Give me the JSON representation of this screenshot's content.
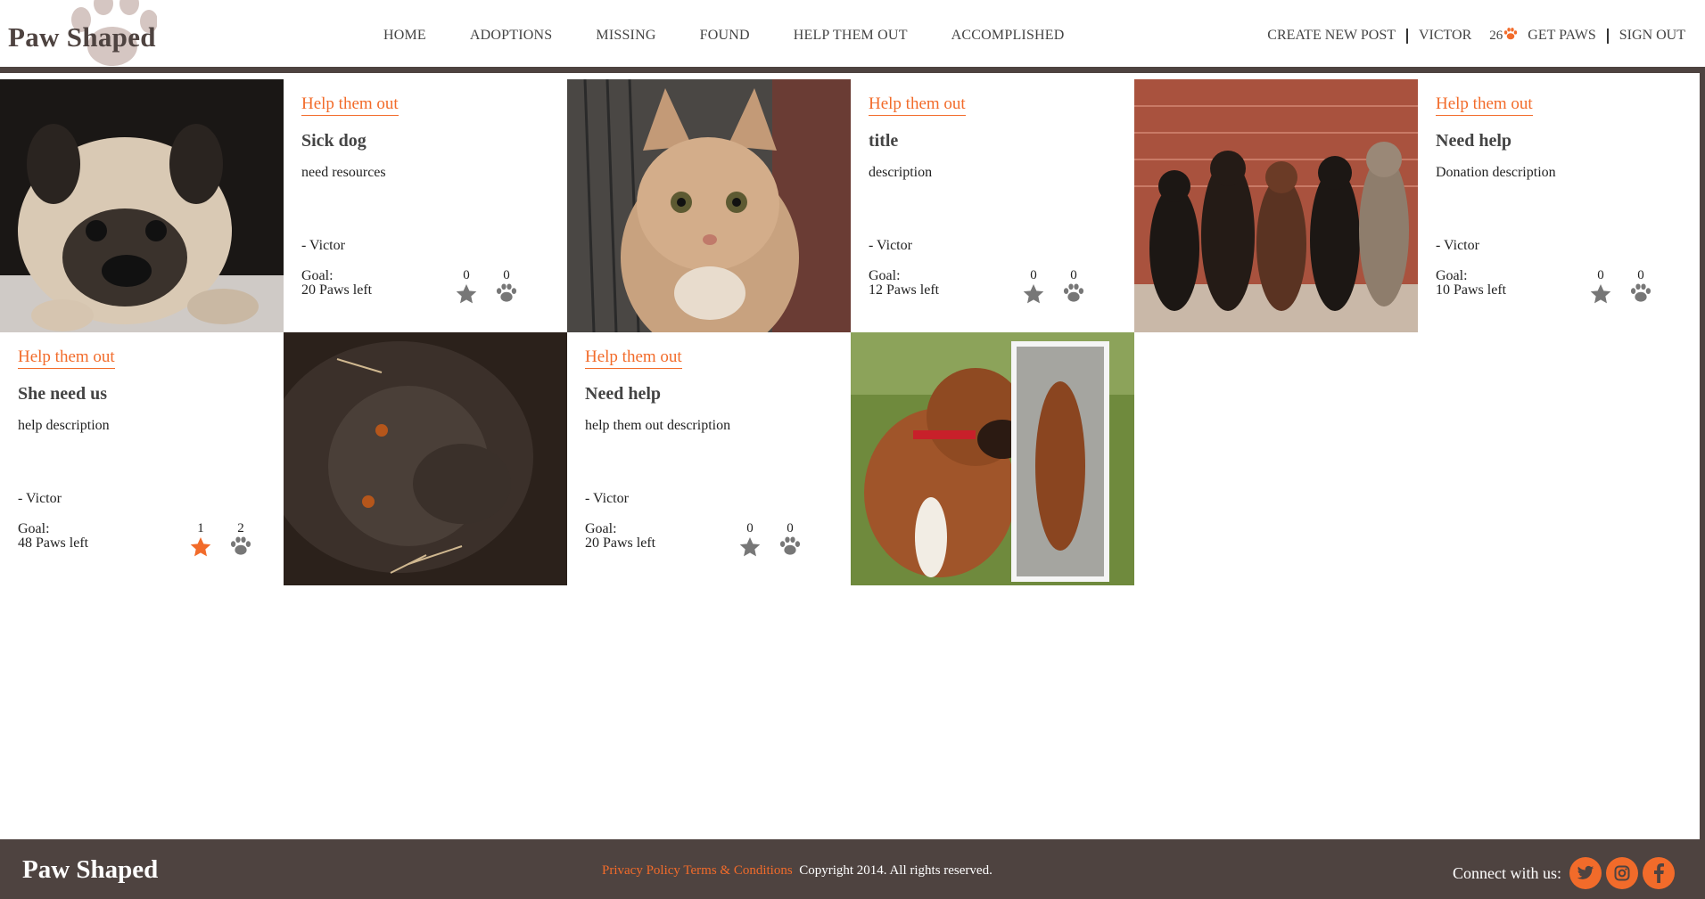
{
  "brand": {
    "name": "Paw Shaped",
    "accent": "#f26b2a",
    "dark": "#4e4340"
  },
  "nav": {
    "items": [
      "HOME",
      "ADOPTIONS",
      "MISSING",
      "FOUND",
      "HELP THEM OUT",
      "ACCOMPLISHED"
    ]
  },
  "user_nav": {
    "create_post": "CREATE NEW POST",
    "username": "VICTOR",
    "paws": "26",
    "paws_icon": "paw-icon",
    "get_paws": "GET PAWS",
    "sign_out": "SIGN OUT"
  },
  "posts": [
    {
      "tag": "Help them out",
      "title": "Sick dog",
      "description": "need resources",
      "author": "- Victor",
      "goal_label": "Goal:",
      "goal_value": "20 Paws left",
      "stars": "0",
      "paws": "0",
      "starred": false,
      "image": "pug"
    },
    {
      "tag": "Help them out",
      "title": "title",
      "description": "description",
      "author": "- Victor",
      "goal_label": "Goal:",
      "goal_value": "12 Paws left",
      "stars": "0",
      "paws": "0",
      "starred": false,
      "image": "cat"
    },
    {
      "tag": "Help them out",
      "title": "Need help",
      "description": "Donation description",
      "author": "- Victor",
      "goal_label": "Goal:",
      "goal_value": "10 Paws left",
      "stars": "0",
      "paws": "0",
      "starred": false,
      "image": "dogs"
    },
    {
      "tag": "Help them out",
      "title": "She need us",
      "description": "help description",
      "author": "- Victor",
      "goal_label": "Goal:",
      "goal_value": "48 Paws left",
      "stars": "1",
      "paws": "2",
      "starred": true,
      "image": "gorilla"
    },
    {
      "tag": "Help them out",
      "title": "Need help",
      "description": "help them out description",
      "author": "- Victor",
      "goal_label": "Goal:",
      "goal_value": "20 Paws left",
      "stars": "0",
      "paws": "0",
      "starred": false,
      "image": "boxer"
    }
  ],
  "footer": {
    "brand": "Paw Shaped",
    "privacy": "Privacy Policy",
    "terms": "Terms & Conditions",
    "copyright": "Copyright 2014. All rights reserved.",
    "connect": "Connect with us:",
    "social": [
      "twitter-icon",
      "instagram-icon",
      "facebook-icon"
    ]
  }
}
